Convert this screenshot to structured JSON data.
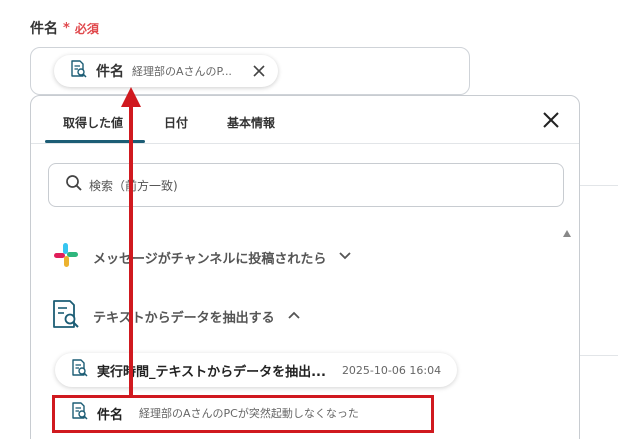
{
  "field": {
    "label": "件名",
    "required_mark": "*",
    "required_text": "必須"
  },
  "selected_chip": {
    "title": "件名",
    "preview": "経理部のAさんのP..."
  },
  "tabs": [
    {
      "label": "取得した値"
    },
    {
      "label": "日付"
    },
    {
      "label": "基本情報"
    }
  ],
  "search": {
    "placeholder": "検索（前方一致)"
  },
  "groups": [
    {
      "label": "メッセージがチャンネルに投稿されたら",
      "icon": "slack-icon",
      "expanded": false
    },
    {
      "label": "テキストからデータを抽出する",
      "icon": "document-search-icon",
      "expanded": true
    }
  ],
  "items": [
    {
      "title": "実行時間_テキストからデータを抽出...",
      "value": "2025-10-06 16:04"
    },
    {
      "title": "件名",
      "value": "経理部のAさんのPCが突然起動しなくなった"
    }
  ],
  "colors": {
    "accent": "#1c5d75",
    "required": "#e0484c",
    "annotation": "#d0191f"
  }
}
